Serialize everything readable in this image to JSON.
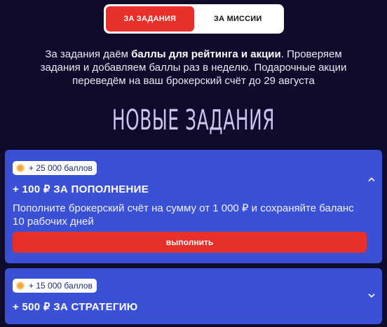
{
  "tabs": [
    {
      "label": "ЗА ЗАДАНИЯ",
      "active": true
    },
    {
      "label": "ЗА МИССИИ",
      "active": false
    }
  ],
  "intro": {
    "line1_a": "За задания даём ",
    "line1_bold": "баллы для рейтинга и акции",
    "line1_b": ". Проверяем",
    "line2": "задания и добавляем баллы раз в неделю. Подарочные акции",
    "line3": "переведём на ваш брокерский счёт до 29 августа"
  },
  "heading": "НОВЫЕ ЗАДАНИЯ",
  "tasks": [
    {
      "points": "+ 25 000 баллов",
      "title": "+ 100 ₽ ЗА ПОПОЛНЕНИЕ",
      "description": "Пополните брокерский счёт на сумму от 1 000 ₽ и сохраняйте баланс 10 рабочих дней",
      "button": "выполнить",
      "expanded": true
    },
    {
      "points": "+ 15 000 баллов",
      "title": "+ 500 ₽ ЗА СТРАТЕГИЮ",
      "expanded": false
    }
  ],
  "colors": {
    "background": "#0e0b2b",
    "card": "#3a51d6",
    "accent_red": "#e8302a",
    "coin": "#f3a93a"
  }
}
